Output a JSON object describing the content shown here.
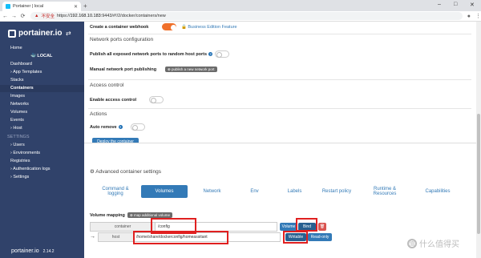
{
  "browser": {
    "tab_title": "Portainer | local",
    "new_tab": "+",
    "security_warning": "不安全",
    "url_prefix": "https://",
    "url_host": "192.168.10.183",
    "url_rest": ":9443/#!/2/docker/containers/new",
    "window_controls": [
      "–",
      "□",
      "✕"
    ],
    "nav": [
      "←",
      "→",
      "⟳"
    ]
  },
  "sidebar": {
    "brand": "portainer.io",
    "env_label": "LOCAL",
    "items": [
      {
        "label": "Home",
        "active": false
      },
      {
        "label": "Dashboard",
        "active": false
      },
      {
        "label": "App Templates",
        "active": false
      },
      {
        "label": "Stacks",
        "active": false
      },
      {
        "label": "Containers",
        "active": true
      },
      {
        "label": "Images",
        "active": false
      },
      {
        "label": "Networks",
        "active": false
      },
      {
        "label": "Volumes",
        "active": false
      },
      {
        "label": "Events",
        "active": false
      },
      {
        "label": "Host",
        "active": false
      }
    ],
    "settings_header": "SETTINGS",
    "settings_items": [
      "Users",
      "Environments",
      "Registries",
      "Authentication logs",
      "Settings"
    ],
    "footer_brand": "portainer.io",
    "version": "2.14.2"
  },
  "form": {
    "webhook_label": "Create a container webhook",
    "business_badge": "Business Edition Feature",
    "network_ports_header": "Network ports configuration",
    "publish_all_label": "Publish all exposed network ports to random host ports",
    "manual_publish_label": "Manual network port publishing",
    "publish_new_port_button": "publish a new network port",
    "access_control_header": "Access control",
    "enable_access_label": "Enable access control",
    "actions_header": "Actions",
    "auto_remove_label": "Auto remove",
    "deploy_button": "Deploy the container"
  },
  "advanced": {
    "header": "Advanced container settings",
    "tabs": [
      {
        "label": "Command & logging",
        "active": false
      },
      {
        "label": "Volumes",
        "active": true
      },
      {
        "label": "Network",
        "active": false
      },
      {
        "label": "Env",
        "active": false
      },
      {
        "label": "Labels",
        "active": false
      },
      {
        "label": "Restart policy",
        "active": false
      },
      {
        "label": "Runtime & Resources",
        "active": false
      },
      {
        "label": "Capabilities",
        "active": false
      }
    ],
    "volume_mapping_label": "Volume mapping",
    "map_volume_button": "map additional volume",
    "container_label": "container",
    "container_value": "/config",
    "volume_button": "Volume",
    "bind_button": "Bind",
    "host_label": "host",
    "host_value": "/home/share/dockerconfig/homeassitant",
    "writable_button": "Writable",
    "readonly_button": "Read-only"
  },
  "watermark": "什么值得买",
  "colors": {
    "sidebar": "#30426a",
    "accent": "#337ab7",
    "toggle_on": "#f0702a",
    "annotation": "#e02020"
  }
}
